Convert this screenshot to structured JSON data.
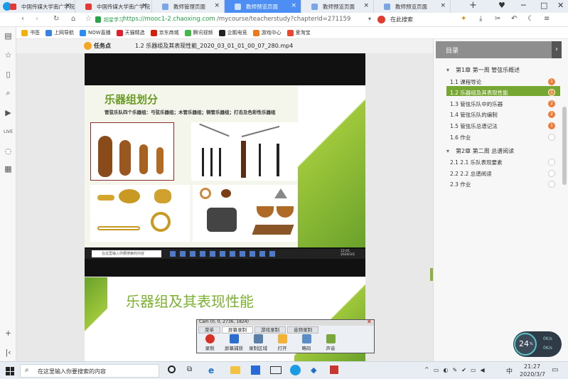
{
  "tabs": [
    {
      "label": "中国传媒大学南广学院",
      "active": false,
      "fav": "#e53935"
    },
    {
      "label": "中国传媒大学南广学院",
      "active": false,
      "fav": "#e53935"
    },
    {
      "label": "教师管理页面",
      "active": false,
      "fav": "#7aa6e6"
    },
    {
      "label": "教师预览页面",
      "active": true,
      "fav": "#cfe0fb"
    },
    {
      "label": "教师预览页面",
      "active": false,
      "fav": "#7aa6e6"
    },
    {
      "label": "教师预览页面",
      "active": false,
      "fav": "#7aa6e6"
    }
  ],
  "new_tab": "+",
  "address": {
    "site_label": "超星学习",
    "url_host": "https://mooc1-2.chaoxing.com",
    "url_path": "/mycourse/teacherstudy?chapterId=271159",
    "search_placeholder": "在此搜索"
  },
  "bookmarks": [
    {
      "label": "书签",
      "color": "#f2b20c"
    },
    {
      "label": "上网导航",
      "color": "#3b82e0"
    },
    {
      "label": "NOW直播",
      "color": "#2c8df6"
    },
    {
      "label": "天猫精选",
      "color": "#e0202a"
    },
    {
      "label": "京东商城",
      "color": "#d81e06"
    },
    {
      "label": "腾讯视频",
      "color": "#47b649"
    },
    {
      "label": "企鹅电竞",
      "color": "#222222"
    },
    {
      "label": "游戏中心",
      "color": "#f07818"
    },
    {
      "label": "爱淘宝",
      "color": "#e9472e"
    }
  ],
  "player": {
    "task_label": "任务点",
    "file_name": "1.2 乐器组及其表现性能_2020_03_01_01_00_07_280.mp4"
  },
  "slide": {
    "title": "乐器组划分",
    "bullet": "管弦乐队四个乐器组：弓弦乐器组；木管乐器组；铜管乐器组；打击及色彩性乐器组",
    "search_box": "在这里输入你要搜索的内容",
    "clock": "12:01\n2020/3/1"
  },
  "slide2": {
    "title": "乐器组及其表现性能"
  },
  "toc": {
    "header": "目录",
    "chapters": [
      {
        "title": "第1章 第一周 管弦乐概述",
        "items": [
          {
            "label": "1.1 课程导论",
            "badge": "1",
            "state": "badge"
          },
          {
            "label": "1.2 乐器组及其表现性能",
            "badge": "5",
            "state": "active"
          },
          {
            "label": "1.3 管弦乐队中的乐器",
            "badge": "2",
            "state": "badge"
          },
          {
            "label": "1.4 管弦乐队的编制",
            "badge": "2",
            "state": "badge"
          },
          {
            "label": "1.5 管弦乐总谱记法",
            "badge": "1",
            "state": "badge"
          },
          {
            "label": "1.6 作业",
            "badge": "",
            "state": "empty"
          }
        ]
      },
      {
        "title": "第2章 第二周 总谱阅读",
        "items": [
          {
            "label": "2.1 2.1 乐队表现要素",
            "badge": "",
            "state": "empty"
          },
          {
            "label": "2.2 2.2 总谱阅读",
            "badge": "",
            "state": "empty"
          },
          {
            "label": "2.3 作业",
            "badge": "",
            "state": "empty"
          }
        ]
      }
    ]
  },
  "netmeter": {
    "percent": "24",
    "unit": "%",
    "up": "0K/s",
    "down": "0K/s"
  },
  "cam": {
    "title": "Cam (0, 0, 2736, 1824)",
    "tabs": [
      "菜单",
      "屏幕录制",
      "游戏录制",
      "音频录制"
    ],
    "buttons": [
      "录制",
      "屏幕捕获",
      "录制区域",
      "打开",
      "略码",
      "声音"
    ]
  },
  "taskbar": {
    "search_placeholder": "在这里输入你要搜索的内容",
    "ime": "中",
    "time": "21:27",
    "date": "2020/3/7"
  }
}
